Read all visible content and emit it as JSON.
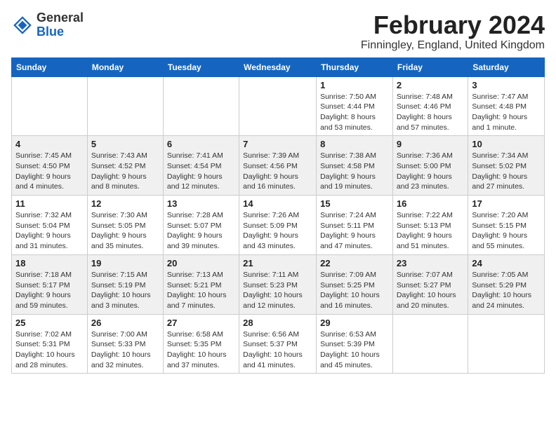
{
  "app": {
    "name_general": "General",
    "name_blue": "Blue"
  },
  "calendar": {
    "title": "February 2024",
    "subtitle": "Finningley, England, United Kingdom",
    "headers": [
      "Sunday",
      "Monday",
      "Tuesday",
      "Wednesday",
      "Thursday",
      "Friday",
      "Saturday"
    ],
    "weeks": [
      [
        {
          "day": "",
          "info": ""
        },
        {
          "day": "",
          "info": ""
        },
        {
          "day": "",
          "info": ""
        },
        {
          "day": "",
          "info": ""
        },
        {
          "day": "1",
          "info": "Sunrise: 7:50 AM\nSunset: 4:44 PM\nDaylight: 8 hours\nand 53 minutes."
        },
        {
          "day": "2",
          "info": "Sunrise: 7:48 AM\nSunset: 4:46 PM\nDaylight: 8 hours\nand 57 minutes."
        },
        {
          "day": "3",
          "info": "Sunrise: 7:47 AM\nSunset: 4:48 PM\nDaylight: 9 hours\nand 1 minute."
        }
      ],
      [
        {
          "day": "4",
          "info": "Sunrise: 7:45 AM\nSunset: 4:50 PM\nDaylight: 9 hours\nand 4 minutes."
        },
        {
          "day": "5",
          "info": "Sunrise: 7:43 AM\nSunset: 4:52 PM\nDaylight: 9 hours\nand 8 minutes."
        },
        {
          "day": "6",
          "info": "Sunrise: 7:41 AM\nSunset: 4:54 PM\nDaylight: 9 hours\nand 12 minutes."
        },
        {
          "day": "7",
          "info": "Sunrise: 7:39 AM\nSunset: 4:56 PM\nDaylight: 9 hours\nand 16 minutes."
        },
        {
          "day": "8",
          "info": "Sunrise: 7:38 AM\nSunset: 4:58 PM\nDaylight: 9 hours\nand 19 minutes."
        },
        {
          "day": "9",
          "info": "Sunrise: 7:36 AM\nSunset: 5:00 PM\nDaylight: 9 hours\nand 23 minutes."
        },
        {
          "day": "10",
          "info": "Sunrise: 7:34 AM\nSunset: 5:02 PM\nDaylight: 9 hours\nand 27 minutes."
        }
      ],
      [
        {
          "day": "11",
          "info": "Sunrise: 7:32 AM\nSunset: 5:04 PM\nDaylight: 9 hours\nand 31 minutes."
        },
        {
          "day": "12",
          "info": "Sunrise: 7:30 AM\nSunset: 5:05 PM\nDaylight: 9 hours\nand 35 minutes."
        },
        {
          "day": "13",
          "info": "Sunrise: 7:28 AM\nSunset: 5:07 PM\nDaylight: 9 hours\nand 39 minutes."
        },
        {
          "day": "14",
          "info": "Sunrise: 7:26 AM\nSunset: 5:09 PM\nDaylight: 9 hours\nand 43 minutes."
        },
        {
          "day": "15",
          "info": "Sunrise: 7:24 AM\nSunset: 5:11 PM\nDaylight: 9 hours\nand 47 minutes."
        },
        {
          "day": "16",
          "info": "Sunrise: 7:22 AM\nSunset: 5:13 PM\nDaylight: 9 hours\nand 51 minutes."
        },
        {
          "day": "17",
          "info": "Sunrise: 7:20 AM\nSunset: 5:15 PM\nDaylight: 9 hours\nand 55 minutes."
        }
      ],
      [
        {
          "day": "18",
          "info": "Sunrise: 7:18 AM\nSunset: 5:17 PM\nDaylight: 9 hours\nand 59 minutes."
        },
        {
          "day": "19",
          "info": "Sunrise: 7:15 AM\nSunset: 5:19 PM\nDaylight: 10 hours\nand 3 minutes."
        },
        {
          "day": "20",
          "info": "Sunrise: 7:13 AM\nSunset: 5:21 PM\nDaylight: 10 hours\nand 7 minutes."
        },
        {
          "day": "21",
          "info": "Sunrise: 7:11 AM\nSunset: 5:23 PM\nDaylight: 10 hours\nand 12 minutes."
        },
        {
          "day": "22",
          "info": "Sunrise: 7:09 AM\nSunset: 5:25 PM\nDaylight: 10 hours\nand 16 minutes."
        },
        {
          "day": "23",
          "info": "Sunrise: 7:07 AM\nSunset: 5:27 PM\nDaylight: 10 hours\nand 20 minutes."
        },
        {
          "day": "24",
          "info": "Sunrise: 7:05 AM\nSunset: 5:29 PM\nDaylight: 10 hours\nand 24 minutes."
        }
      ],
      [
        {
          "day": "25",
          "info": "Sunrise: 7:02 AM\nSunset: 5:31 PM\nDaylight: 10 hours\nand 28 minutes."
        },
        {
          "day": "26",
          "info": "Sunrise: 7:00 AM\nSunset: 5:33 PM\nDaylight: 10 hours\nand 32 minutes."
        },
        {
          "day": "27",
          "info": "Sunrise: 6:58 AM\nSunset: 5:35 PM\nDaylight: 10 hours\nand 37 minutes."
        },
        {
          "day": "28",
          "info": "Sunrise: 6:56 AM\nSunset: 5:37 PM\nDaylight: 10 hours\nand 41 minutes."
        },
        {
          "day": "29",
          "info": "Sunrise: 6:53 AM\nSunset: 5:39 PM\nDaylight: 10 hours\nand 45 minutes."
        },
        {
          "day": "",
          "info": ""
        },
        {
          "day": "",
          "info": ""
        }
      ]
    ]
  }
}
